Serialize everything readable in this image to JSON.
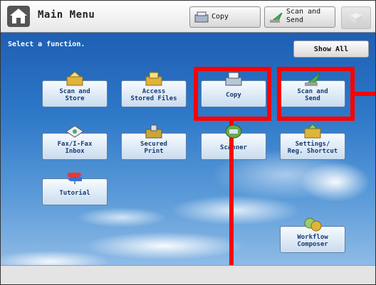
{
  "header": {
    "title": "Main Menu",
    "copy_label": "Copy",
    "scan_send_line1": "Scan and",
    "scan_send_line2": "Send"
  },
  "main": {
    "prompt": "Select a function.",
    "show_all_label": "Show All",
    "functions": [
      {
        "id": "scan-and-store",
        "line1": "Scan and",
        "line2": "Store"
      },
      {
        "id": "access-stored-files",
        "line1": "Access",
        "line2": "Stored Files"
      },
      {
        "id": "copy",
        "line1": "Copy",
        "line2": ""
      },
      {
        "id": "scan-and-send",
        "line1": "Scan and",
        "line2": "Send"
      },
      {
        "id": "fax-ifax-inbox",
        "line1": "Fax/I-Fax",
        "line2": "Inbox"
      },
      {
        "id": "secured-print",
        "line1": "Secured",
        "line2": "Print"
      },
      {
        "id": "scanner",
        "line1": "Scanner",
        "line2": ""
      },
      {
        "id": "settings-reg-shortcut",
        "line1": "Settings/",
        "line2": "Reg. Shortcut"
      },
      {
        "id": "tutorial",
        "line1": "Tutorial",
        "line2": ""
      },
      {
        "id": "workflow-composer",
        "line1": "Workflow",
        "line2": "Composer"
      }
    ]
  },
  "colors": {
    "highlight": "#ff0000",
    "sky": "#2e78c8",
    "button_text": "#173a73"
  }
}
